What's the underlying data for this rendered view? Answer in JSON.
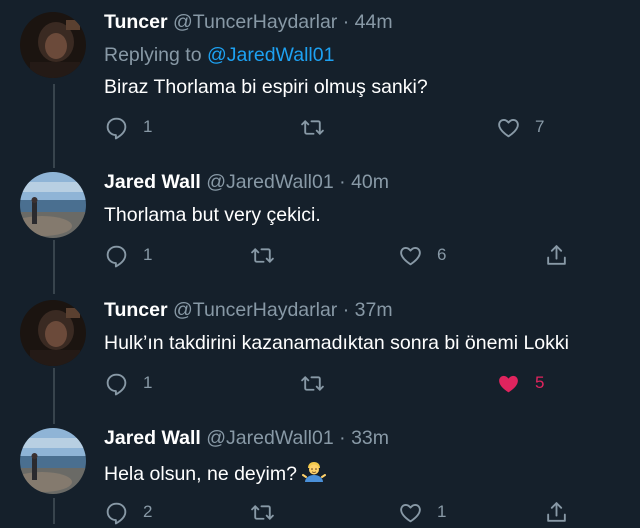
{
  "tweets": [
    {
      "name": "Tuncer",
      "handle": "@TuncerHaydarlar",
      "dot": "·",
      "time": "44m",
      "replying_prefix": "Replying to",
      "replying_to": "@JaredWall01",
      "text": "Biraz Thorlama bi espiri olmuş sanki?",
      "reply_count": "1",
      "retweet_count": "",
      "like_count": "7",
      "liked": false,
      "avatar": "dark-portrait"
    },
    {
      "name": "Jared Wall",
      "handle": "@JaredWall01",
      "dot": "·",
      "time": "40m",
      "text": "Thorlama but very çekici.",
      "reply_count": "1",
      "retweet_count": "",
      "like_count": "6",
      "liked": false,
      "avatar": "seaside-photo"
    },
    {
      "name": "Tuncer",
      "handle": "@TuncerHaydarlar",
      "dot": "·",
      "time": "37m",
      "text": "Hulk’ın takdirini kazanamadıktan sonra bi önemi Lokki",
      "reply_count": "1",
      "retweet_count": "",
      "like_count": "5",
      "liked": true,
      "avatar": "dark-portrait"
    },
    {
      "name": "Jared Wall",
      "handle": "@JaredWall01",
      "dot": "·",
      "time": "33m",
      "text": "Hela olsun, ne deyim?",
      "emoji": "person-shrugging",
      "reply_count": "2",
      "retweet_count": "",
      "like_count": "1",
      "liked": false,
      "avatar": "seaside-photo"
    }
  ],
  "colors": {
    "background": "#15202b",
    "secondary_text": "#8899a6",
    "link": "#1da1f2",
    "like": "#e0245e",
    "thread_line": "#38444d"
  }
}
